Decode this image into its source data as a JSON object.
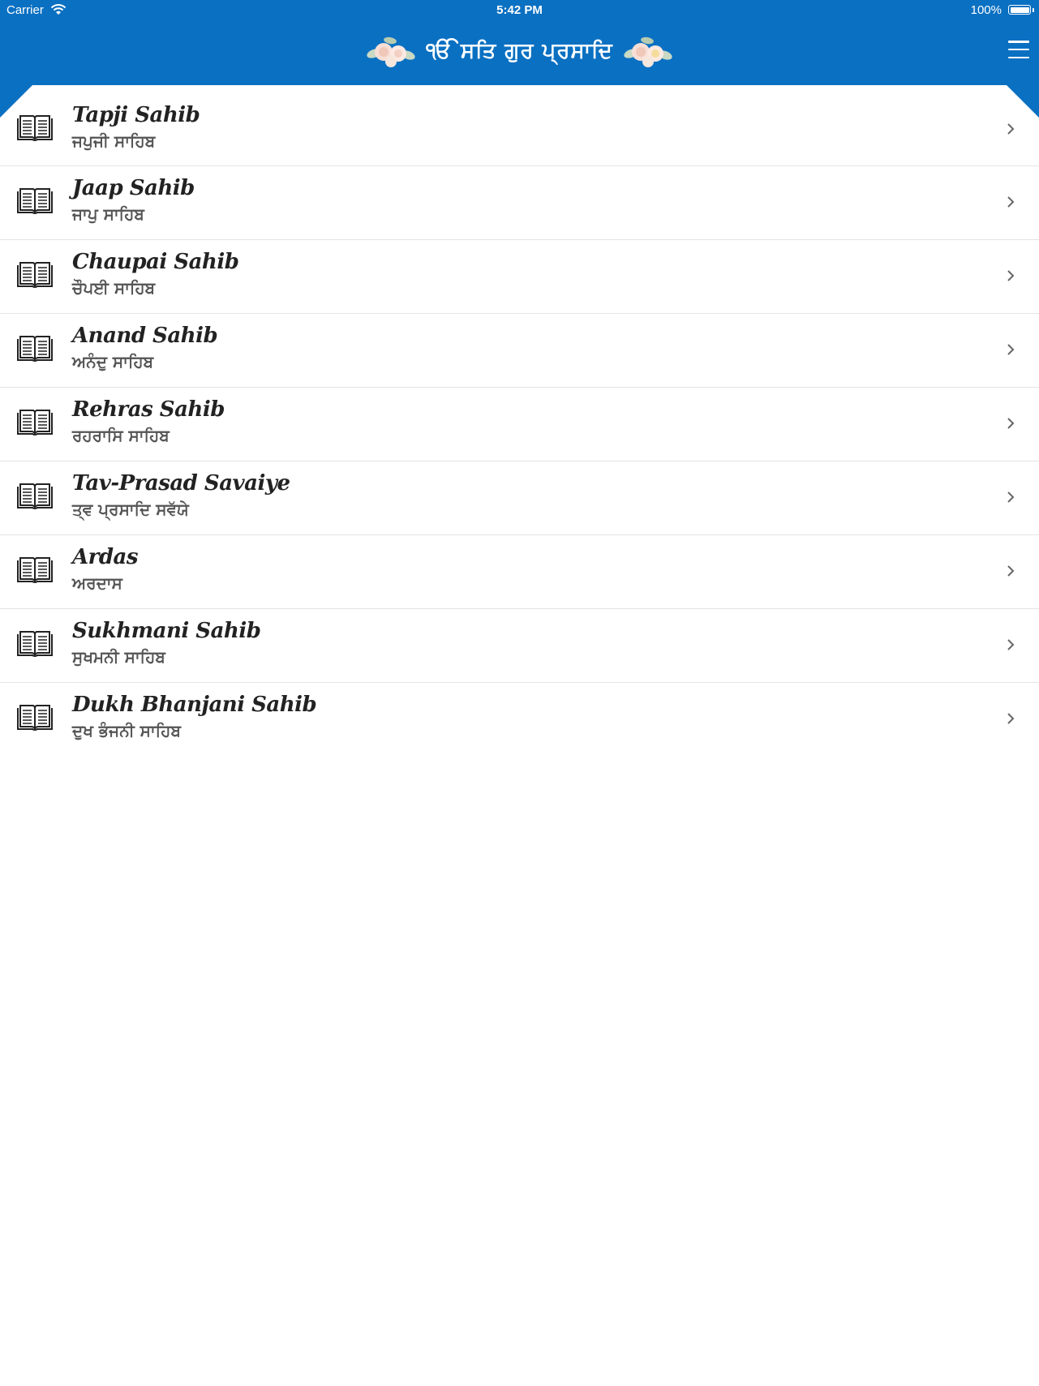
{
  "status_bar": {
    "carrier": "Carrier",
    "time": "5:42 PM",
    "battery": "100%"
  },
  "header": {
    "title": "ੴ ਸਤਿ ਗੁਰ ਪ੍ਰਸਾਦਿ",
    "color": "#0a70c2",
    "left_decoration": "flower-icon",
    "right_decoration": "flower-icon",
    "menu_icon": "hamburger-menu-icon"
  },
  "list": {
    "items": [
      {
        "title": "Tapji Sahib",
        "subtitle": "ਜਪੁਜੀ ਸਾਹਿਬ"
      },
      {
        "title": "Jaap Sahib",
        "subtitle": "ਜਾਪੁ ਸਾਹਿਬ"
      },
      {
        "title": "Chaupai Sahib",
        "subtitle": "ਚੌਪਈ ਸਾਹਿਬ"
      },
      {
        "title": "Anand Sahib",
        "subtitle": "ਅਨੰਦੁ ਸਾਹਿਬ"
      },
      {
        "title": "Rehras Sahib",
        "subtitle": "ਰਹਰਾਸਿ ਸਾਹਿਬ"
      },
      {
        "title": "Tav-Prasad Savaiye",
        "subtitle": "ਤ੍ਵ ਪ੍ਰਸਾਦਿ ਸਵੱਯੇ"
      },
      {
        "title": "Ardas",
        "subtitle": "ਅਰਦਾਸ"
      },
      {
        "title": "Sukhmani Sahib",
        "subtitle": "ਸੁਖਮਨੀ ਸਾਹਿਬ"
      },
      {
        "title": "Dukh Bhanjani Sahib",
        "subtitle": "ਦੁਖ ਭੰਜਨੀ ਸਾਹਿਬ"
      }
    ],
    "row_icon": "open-book-icon",
    "row_accessory": "chevron-right-icon"
  }
}
